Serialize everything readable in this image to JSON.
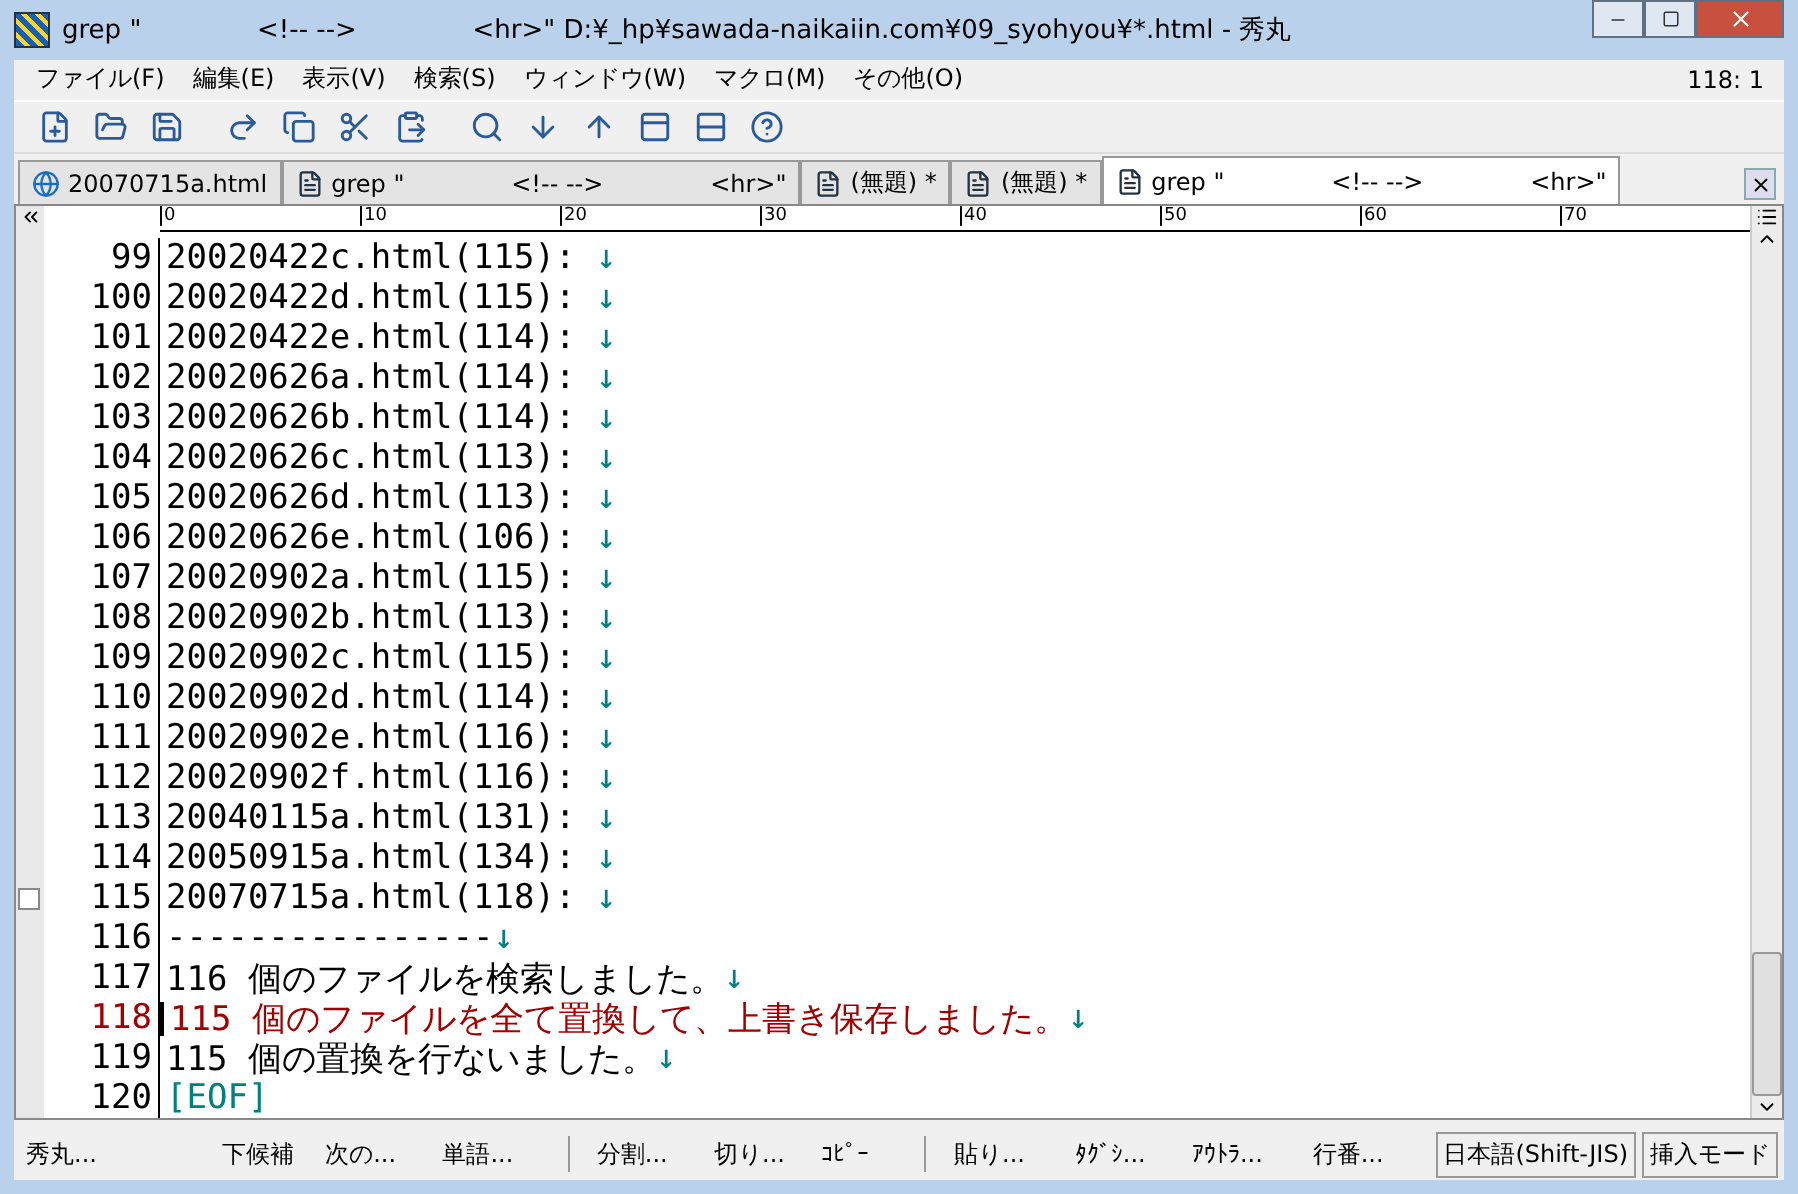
{
  "window": {
    "title": "grep \"              <!-- -->              <hr>\" D:¥_hp¥sawada-naikaiin.com¥09_syohyou¥*.html - 秀丸"
  },
  "menu": {
    "items": [
      "ファイル(F)",
      "編集(E)",
      "表示(V)",
      "検索(S)",
      "ウィンドウ(W)",
      "マクロ(M)",
      "その他(O)"
    ],
    "cursor": "118: 1"
  },
  "tabs": [
    {
      "label": "20070715a.html",
      "kind": "web",
      "selected": false
    },
    {
      "label": "grep \"              <!-- -->              <hr>\"",
      "kind": "doc",
      "selected": false
    },
    {
      "label": "(無題) *",
      "kind": "doc",
      "selected": false
    },
    {
      "label": "(無題) *",
      "kind": "doc",
      "selected": false
    },
    {
      "label": "grep \"              <!-- -->              <hr>\"",
      "kind": "doc",
      "selected": true
    }
  ],
  "ruler": [
    "0",
    "10",
    "20",
    "30",
    "40",
    "50",
    "60",
    "70"
  ],
  "lines": [
    {
      "number": "99",
      "text": "20020422c.html(115): ",
      "eol": "↓",
      "kind": "normal"
    },
    {
      "number": "100",
      "text": "20020422d.html(115): ",
      "eol": "↓",
      "kind": "normal"
    },
    {
      "number": "101",
      "text": "20020422e.html(114): ",
      "eol": "↓",
      "kind": "normal"
    },
    {
      "number": "102",
      "text": "20020626a.html(114): ",
      "eol": "↓",
      "kind": "normal"
    },
    {
      "number": "103",
      "text": "20020626b.html(114): ",
      "eol": "↓",
      "kind": "normal"
    },
    {
      "number": "104",
      "text": "20020626c.html(113): ",
      "eol": "↓",
      "kind": "normal"
    },
    {
      "number": "105",
      "text": "20020626d.html(113): ",
      "eol": "↓",
      "kind": "normal"
    },
    {
      "number": "106",
      "text": "20020626e.html(106): ",
      "eol": "↓",
      "kind": "normal"
    },
    {
      "number": "107",
      "text": "20020902a.html(115): ",
      "eol": "↓",
      "kind": "normal"
    },
    {
      "number": "108",
      "text": "20020902b.html(113): ",
      "eol": "↓",
      "kind": "normal"
    },
    {
      "number": "109",
      "text": "20020902c.html(115): ",
      "eol": "↓",
      "kind": "normal"
    },
    {
      "number": "110",
      "text": "20020902d.html(114): ",
      "eol": "↓",
      "kind": "normal"
    },
    {
      "number": "111",
      "text": "20020902e.html(116): ",
      "eol": "↓",
      "kind": "normal"
    },
    {
      "number": "112",
      "text": "20020902f.html(116): ",
      "eol": "↓",
      "kind": "normal"
    },
    {
      "number": "113",
      "text": "20040115a.html(131): ",
      "eol": "↓",
      "kind": "normal"
    },
    {
      "number": "114",
      "text": "20050915a.html(134): ",
      "eol": "↓",
      "kind": "normal"
    },
    {
      "number": "115",
      "text": "20070715a.html(118): ",
      "eol": "↓",
      "kind": "fold"
    },
    {
      "number": "116",
      "text": "----------------",
      "eol": "↓",
      "kind": "normal"
    },
    {
      "number": "117",
      "text": "116 個のファイルを検索しました。",
      "eol": "↓",
      "kind": "normal"
    },
    {
      "number": "118",
      "text": "115 個のファイルを全て置換して、上書き保存しました。",
      "eol": "↓",
      "kind": "current"
    },
    {
      "number": "119",
      "text": "115 個の置換を行ないました。",
      "eol": "↓",
      "kind": "normal"
    },
    {
      "number": "120",
      "text": "[EOF]",
      "kind": "eof"
    }
  ],
  "status_bar": {
    "items": [
      "秀丸...",
      "下候補",
      "次の...",
      "単語...",
      "分割...",
      "切り...",
      "ｺﾋﾟｰ",
      "貼り...",
      "ﾀｸﾞｼ...",
      "ｱｳﾄﾗ...",
      "行番..."
    ],
    "encoding": "日本語(Shift-JIS)",
    "mode": "挿入モード"
  }
}
